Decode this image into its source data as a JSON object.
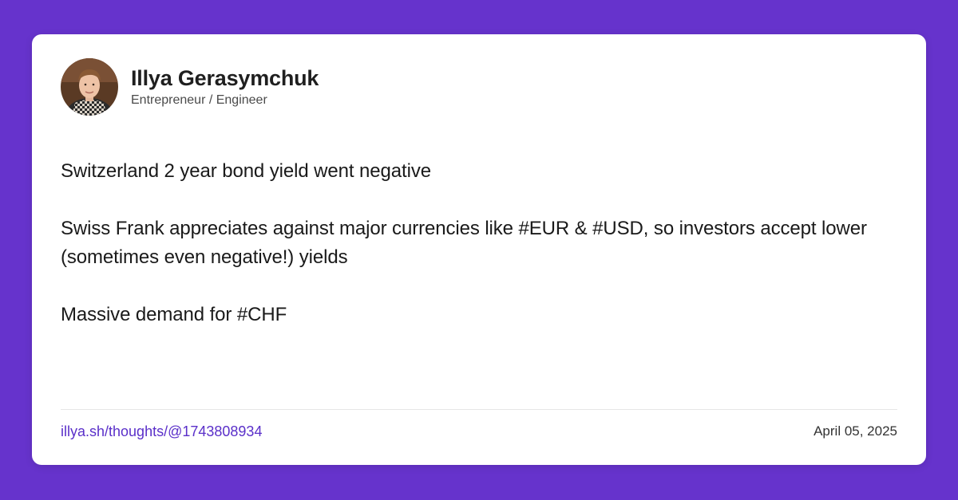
{
  "author": {
    "name": "Illya Gerasymchuk",
    "title": "Entrepreneur / Engineer",
    "avatar_icon": "avatar-photo"
  },
  "post": {
    "paragraphs": [
      "Switzerland 2 year bond yield went negative",
      "Swiss Frank appreciates against major currencies like #EUR & #USD, so investors accept lower (sometimes even negative!) yields",
      "Massive demand for #CHF"
    ]
  },
  "footer": {
    "link_text": "illya.sh/thoughts/@1743808934",
    "date": "April 05, 2025"
  },
  "colors": {
    "background": "#6633cc",
    "card": "#ffffff",
    "link": "#5a2fc9",
    "text": "#1a1a1a"
  }
}
